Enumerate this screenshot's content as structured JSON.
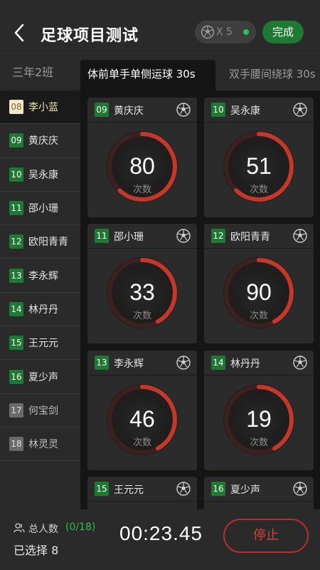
{
  "header": {
    "title": "足球项目测试",
    "ball_count": "X 5",
    "done_label": "完成"
  },
  "tabs": {
    "class_name": "三年2班",
    "tests": [
      {
        "label": "体前单手单侧运球 30s"
      },
      {
        "label": "双手腰间绕球 30s"
      }
    ]
  },
  "sidebar": {
    "items": [
      {
        "num": "08",
        "name": "李小蓝",
        "state": "selected"
      },
      {
        "num": "09",
        "name": "黄庆庆",
        "state": "active"
      },
      {
        "num": "10",
        "name": "吴永康",
        "state": "active"
      },
      {
        "num": "11",
        "name": "邵小珊",
        "state": "active"
      },
      {
        "num": "12",
        "name": "欧阳青青",
        "state": "active"
      },
      {
        "num": "13",
        "name": "李永辉",
        "state": "active"
      },
      {
        "num": "14",
        "name": "林丹丹",
        "state": "active"
      },
      {
        "num": "15",
        "name": "王元元",
        "state": "active"
      },
      {
        "num": "16",
        "name": "夏少声",
        "state": "active"
      },
      {
        "num": "17",
        "name": "何宝剑",
        "state": "inactive"
      },
      {
        "num": "18",
        "name": "林灵灵",
        "state": "inactive"
      }
    ]
  },
  "cards": [
    {
      "num": "09",
      "name": "黄庆庆",
      "value": "80",
      "unit": "次数",
      "progress": 0.62
    },
    {
      "num": "10",
      "name": "吴永康",
      "value": "51",
      "unit": "次数",
      "progress": 0.62
    },
    {
      "num": "11",
      "name": "邵小珊",
      "value": "33",
      "unit": "次数",
      "progress": 0.42
    },
    {
      "num": "12",
      "name": "欧阳青青",
      "value": "90",
      "unit": "次数",
      "progress": 0.42
    },
    {
      "num": "13",
      "name": "李永辉",
      "value": "46",
      "unit": "次数",
      "progress": 0.42
    },
    {
      "num": "14",
      "name": "林丹丹",
      "value": "19",
      "unit": "次数",
      "progress": 0.42
    },
    {
      "num": "15",
      "name": "王元元",
      "value": "",
      "unit": "",
      "progress": 0
    },
    {
      "num": "16",
      "name": "夏少声",
      "value": "",
      "unit": "",
      "progress": 0
    }
  ],
  "footer": {
    "total_label": "总人数",
    "total_count": "(0/18)",
    "selected_label": "已选择 8",
    "timer": "00:23.45",
    "stop_label": "停止"
  },
  "colors": {
    "accent_green": "#1e7a33",
    "gauge_red": "#c0392b",
    "stop_red": "#d6403a"
  }
}
